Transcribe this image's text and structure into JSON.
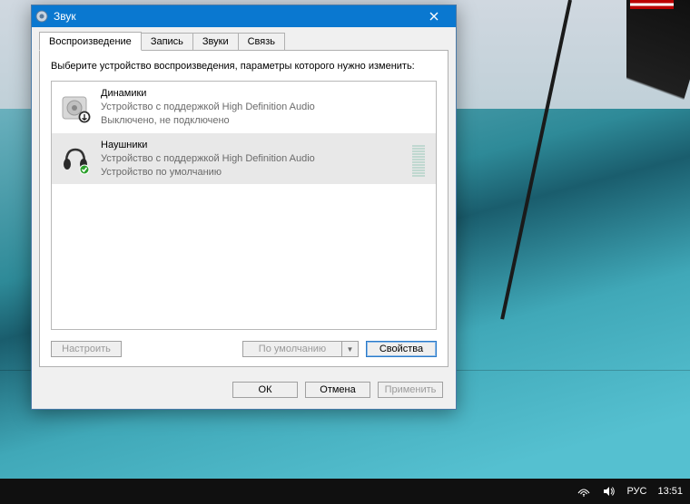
{
  "window": {
    "title": "Звук",
    "close_tooltip": "Close"
  },
  "tabs": [
    {
      "label": "Воспроизведение",
      "active": true
    },
    {
      "label": "Запись",
      "active": false
    },
    {
      "label": "Звуки",
      "active": false
    },
    {
      "label": "Связь",
      "active": false
    }
  ],
  "instruction": "Выберите устройство воспроизведения, параметры которого нужно изменить:",
  "devices": [
    {
      "name": "Динамики",
      "desc": "Устройство с поддержкой High Definition Audio",
      "status": "Выключено, не подключено",
      "icon": "speaker",
      "badge": "disabled",
      "selected": false
    },
    {
      "name": "Наушники",
      "desc": "Устройство с поддержкой High Definition Audio",
      "status": "Устройство по умолчанию",
      "icon": "headphones",
      "badge": "default",
      "selected": true
    }
  ],
  "buttons": {
    "configure": "Настроить",
    "set_default": "По умолчанию",
    "properties": "Свойства",
    "ok": "ОК",
    "cancel": "Отмена",
    "apply": "Применить"
  },
  "taskbar": {
    "lang": "РУС",
    "time": "13:51"
  }
}
